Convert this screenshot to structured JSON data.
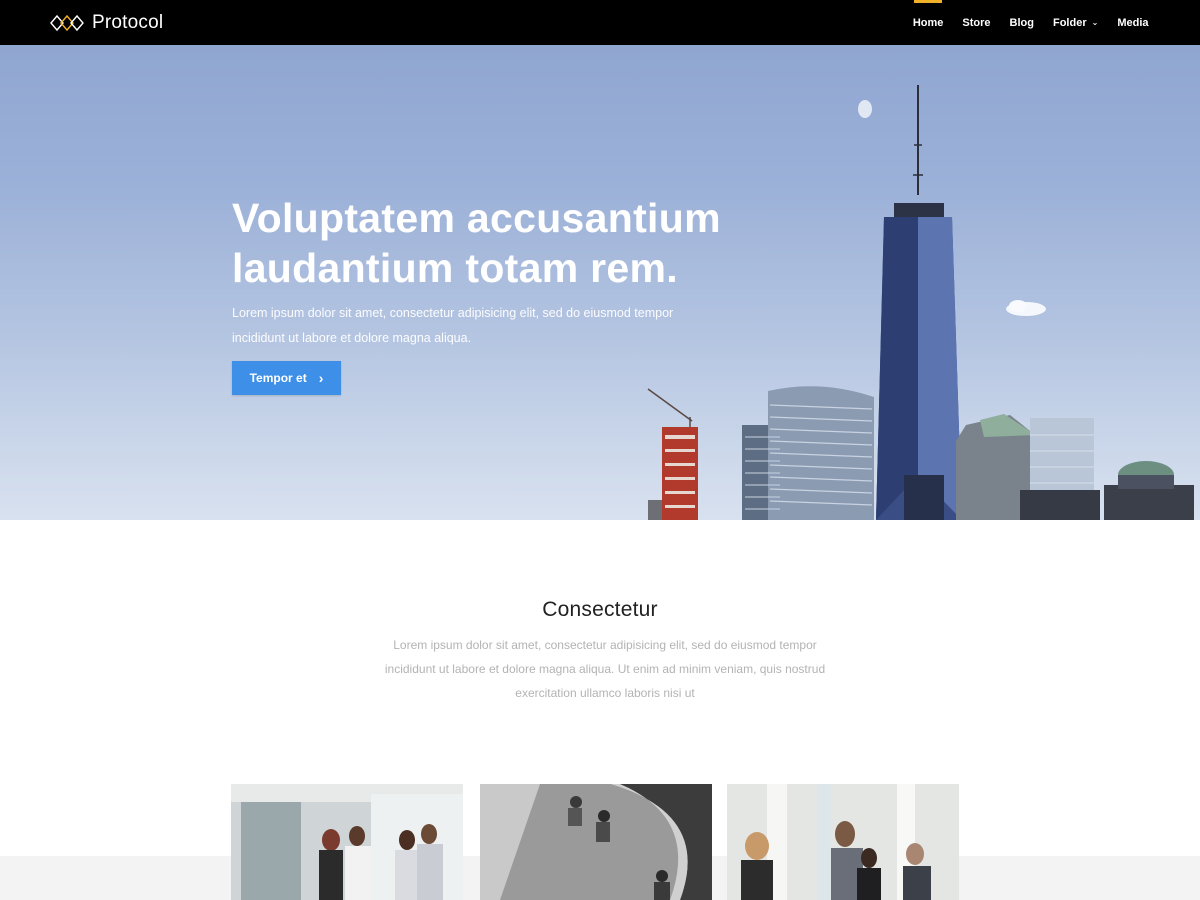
{
  "brand": {
    "name": "Protocol"
  },
  "nav": {
    "items": [
      {
        "label": "Home"
      },
      {
        "label": "Store"
      },
      {
        "label": "Blog"
      },
      {
        "label": "Folder"
      },
      {
        "label": "Media"
      }
    ]
  },
  "hero": {
    "title_line1": "Voluptatem accusantium",
    "title_line2": "laudantium totam rem.",
    "description_line1": "Lorem ipsum dolor sit amet, consectetur adipisicing elit, sed do eiusmod tempor",
    "description_line2": "incididunt ut labore et dolore magna aliqua.",
    "button_label": "Tempor et"
  },
  "intro": {
    "title": "Consectetur",
    "text_line1": "Lorem ipsum dolor sit amet, consectetur adipisicing elit, sed do eiusmod tempor",
    "text_line2": "incididunt ut labore et dolore magna aliqua. Ut enim ad minim veniam, quis nostrud",
    "text_line3": "exercitation ullamco laboris nisi ut"
  },
  "colors": {
    "header_bg": "#000000",
    "accent": "#f0b129",
    "button": "#3d8fe8"
  }
}
